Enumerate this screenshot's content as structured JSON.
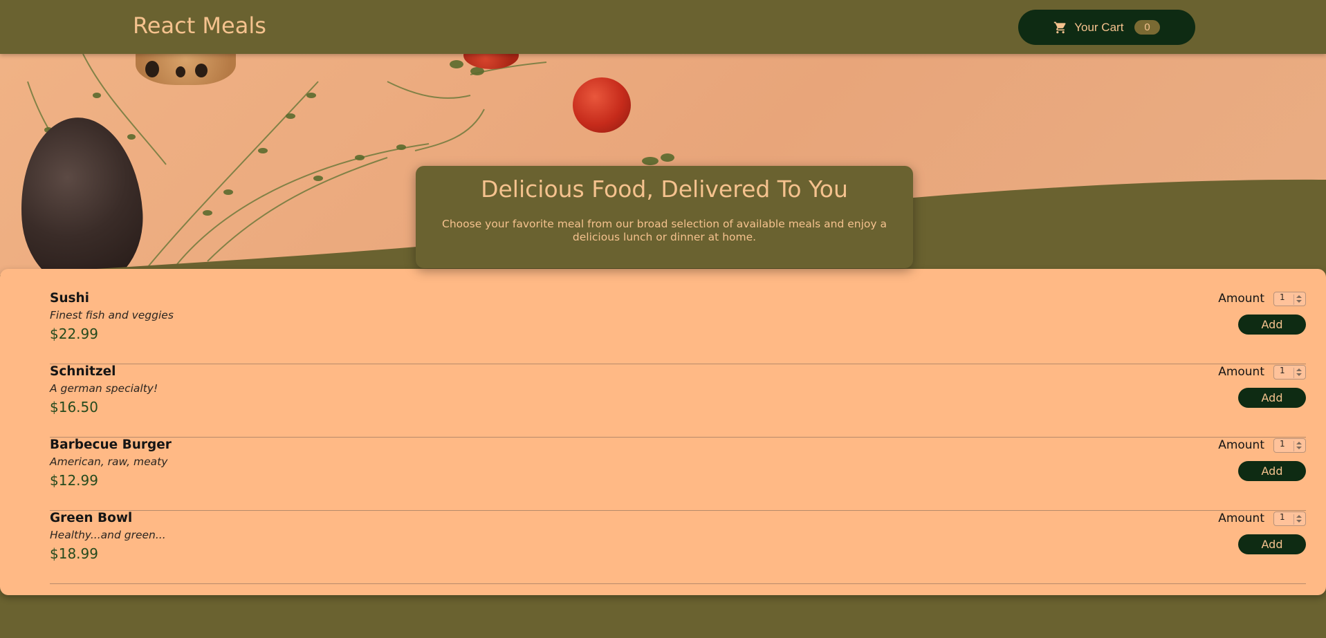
{
  "header": {
    "logo": "React Meals",
    "cart_label": "Your Cart",
    "cart_count": "0"
  },
  "intro": {
    "title": "Delicious Food, Delivered To You",
    "text": "Choose your favorite meal from our broad selection of available meals and enjoy a delicious lunch or dinner at home."
  },
  "meals": [
    {
      "name": "Sushi",
      "description": "Finest fish and veggies",
      "price": "$22.99",
      "amount_label": "Amount",
      "amount": "1",
      "add_label": "Add"
    },
    {
      "name": "Schnitzel",
      "description": "A german specialty!",
      "price": "$16.50",
      "amount_label": "Amount",
      "amount": "1",
      "add_label": "Add"
    },
    {
      "name": "Barbecue Burger",
      "description": "American, raw, meaty",
      "price": "$12.99",
      "amount_label": "Amount",
      "amount": "1",
      "add_label": "Add"
    },
    {
      "name": "Green Bowl",
      "description": "Healthy...and green...",
      "price": "$18.99",
      "amount_label": "Amount",
      "amount": "1",
      "add_label": "Add"
    }
  ],
  "colors": {
    "header_bg": "#6a6230",
    "accent_text": "#f5c28e",
    "button_bg": "#0e2b13",
    "card_bg": "#ffb985",
    "price_text": "#254a1d"
  },
  "icons": {
    "cart": "cart-icon"
  }
}
